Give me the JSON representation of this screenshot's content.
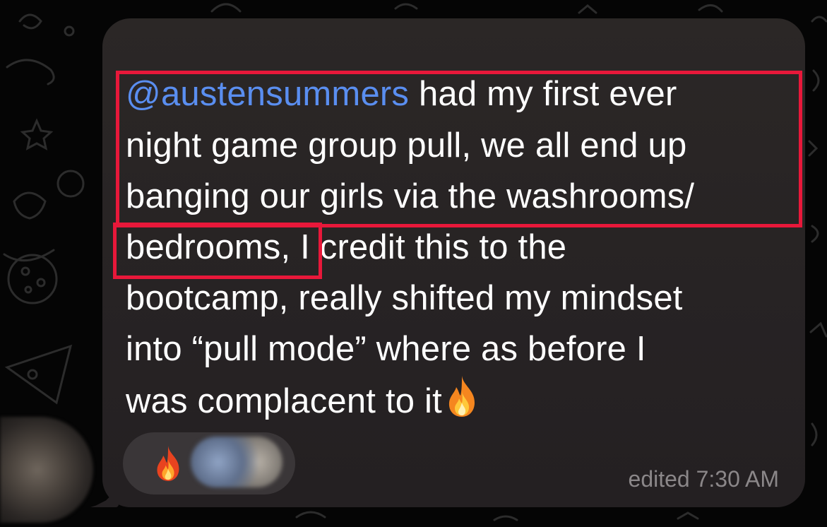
{
  "message": {
    "mention": "@austensummers",
    "lines": [
      " had my first ever",
      "night game group pull, we all end up",
      "banging our girls via the washrooms/",
      "bedrooms,",
      " I credit this to the",
      "bootcamp, really shifted my mindset",
      "into “pull mode” where as before I",
      "was complacent to it"
    ],
    "trailing_emoji": "fire-emoji"
  },
  "reactions": [
    {
      "emoji": "fire-emoji",
      "reactors": "blurred-avatars"
    }
  ],
  "footer": {
    "edited_label": "edited 7:30 AM"
  },
  "colors": {
    "bubble": "#2b2726",
    "mention": "#5a8ef0",
    "highlight": "#e8183a",
    "timestamp": "#8b8789"
  }
}
